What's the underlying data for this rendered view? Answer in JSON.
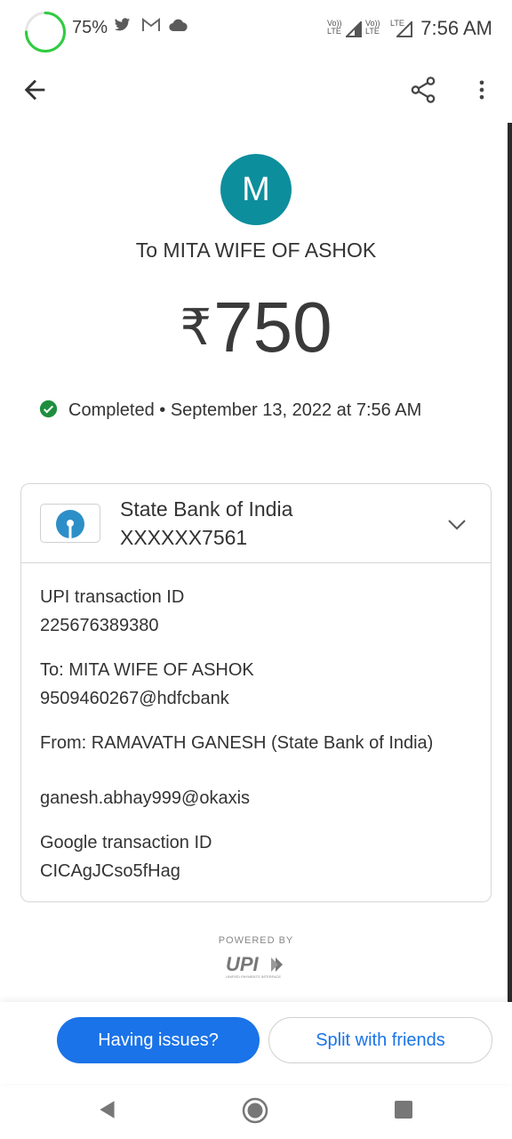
{
  "status_bar": {
    "battery": "75%",
    "battery_level": 0.75,
    "icons": [
      "twitter-icon",
      "gmail-icon",
      "cloud-icon",
      "volte-lte-icon",
      "signal-icon",
      "volte-lte-icon",
      "signal-icon"
    ],
    "lte1": "Vo)) LTE",
    "lte2": "Vo)) LTE",
    "lte3": "LTE",
    "time": "7:56 AM"
  },
  "app_bar": {
    "icons": [
      "back-arrow-icon",
      "share-icon",
      "more-vert-icon"
    ]
  },
  "transaction": {
    "avatar_letter": "M",
    "recipient": "To MITA WIFE OF ASHOK",
    "currency": "₹",
    "amount": "750",
    "status": "Completed • September 13, 2022 at 7:56 AM",
    "status_color": "#1e8e3e"
  },
  "bank": {
    "name": "State Bank of India",
    "account": "XXXXXX7561"
  },
  "details": {
    "upi_id_label": "UPI transaction ID",
    "upi_id_value": "225676389380",
    "to_label": "To: MITA WIFE OF ASHOK",
    "to_value": "9509460267@hdfcbank",
    "from_label": "From: RAMAVATH  GANESH (State Bank of India)",
    "from_value": "ganesh.abhay999@okaxis",
    "google_id_label": "Google transaction ID",
    "google_id_value": "CICAgJCso5fHag"
  },
  "footer": {
    "powered_by": "POWERED BY",
    "upi_logo_text": "UPI",
    "upi_logo_subtext": "UNIFIED PAYMENTS INTERFACE"
  },
  "actions": {
    "having_issues": "Having issues?",
    "split": "Split with friends"
  },
  "colors": {
    "accent": "#1a73e8",
    "avatar": "#0d8e9c",
    "sbi_blue": "#2d8fc8"
  }
}
